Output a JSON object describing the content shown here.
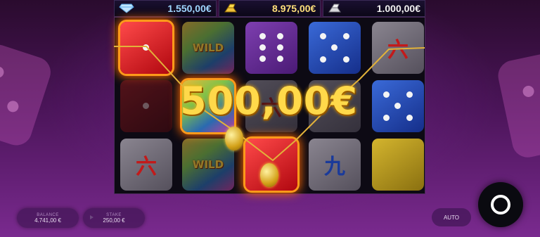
{
  "jackpots": [
    {
      "icon": "diamond-icon",
      "value": "1.550,00€"
    },
    {
      "icon": "gold-bars-icon",
      "value": "8.975,00€"
    },
    {
      "icon": "silver-bars-icon",
      "value": "1.000,00€"
    }
  ],
  "symbols": {
    "wild": "WILD",
    "six_char": "六",
    "nine_char": "九"
  },
  "win": {
    "amount": "500,00€"
  },
  "balance": {
    "label": "BALANCE",
    "value": "4.741,00 €"
  },
  "stake": {
    "label": "STAKE",
    "value": "250,00 €"
  },
  "auto": {
    "label": "AUTO"
  },
  "colors": {
    "win_gold": "#ffd94a",
    "win_glow": "#ff9a1a",
    "payline": "#e2b23a"
  }
}
